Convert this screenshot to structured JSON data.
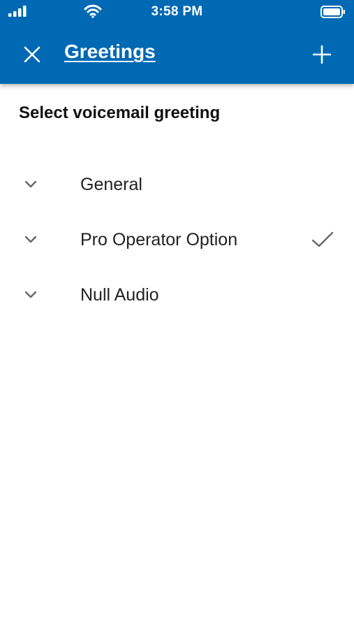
{
  "status_bar": {
    "time": "3:58 PM",
    "icons": [
      "signal-icon",
      "wifi-icon",
      "battery-icon"
    ]
  },
  "app_bar": {
    "title": "Greetings",
    "close_icon": "close-icon",
    "add_icon": "plus-icon",
    "background_color": "#0069b4"
  },
  "main": {
    "section_title": "Select voicemail greeting",
    "greetings": [
      {
        "label": "General",
        "selected": false
      },
      {
        "label": "Pro Operator Option",
        "selected": true
      },
      {
        "label": "Null Audio",
        "selected": false
      }
    ]
  }
}
